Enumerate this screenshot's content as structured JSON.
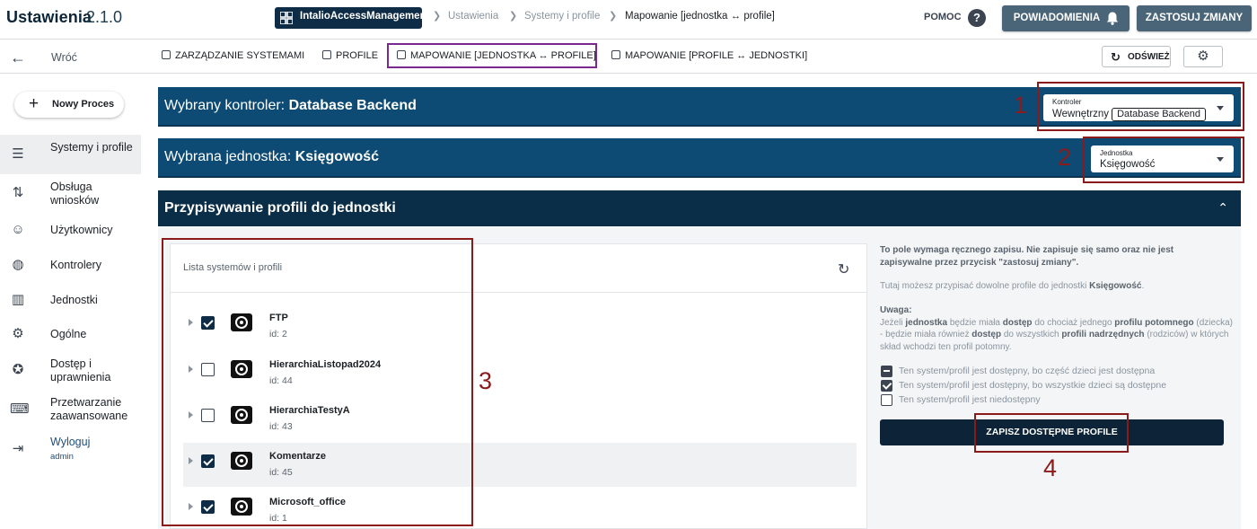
{
  "header": {
    "title": "Ustawienia",
    "version": "2.1.0",
    "breadcrumb": {
      "app": "IntalioAccessManagement",
      "items": [
        "Ustawienia",
        "Systemy i profile"
      ],
      "current": "Mapowanie [jednostka ↔ profile]"
    },
    "help_label": "POMOC",
    "notifications_label": "POWIADOMIENIA",
    "apply_label": "ZASTOSUJ ZMIANY"
  },
  "subnav": {
    "back_label": "Wróć",
    "tabs": [
      {
        "label": "ZARZĄDZANIE SYSTEMAMI"
      },
      {
        "label": "PROFILE"
      },
      {
        "label": "MAPOWANIE [JEDNOSTKA ↔ PROFILE]"
      },
      {
        "label": "MAPOWANIE [PROFILE ↔ JEDNOSTKI]"
      }
    ],
    "active_tab": "MAPOWANIE [JEDNOSTKA ↔ PROFILE]",
    "refresh_label": "ODŚWIEŻ"
  },
  "sidebar": {
    "new_process_label": "Nowy Proces",
    "items": [
      {
        "label": "Systemy i profile",
        "icon": "server-icon",
        "active": true
      },
      {
        "label": "Obsługa wniosków",
        "icon": "workflow-icon"
      },
      {
        "label": "Użytkownicy",
        "icon": "users-icon"
      },
      {
        "label": "Kontrolery",
        "icon": "globe-icon"
      },
      {
        "label": "Jednostki",
        "icon": "building-icon"
      },
      {
        "label": "Ogólne",
        "icon": "settings-chip-icon"
      },
      {
        "label": "Dostęp i uprawnienia",
        "icon": "badge-icon"
      },
      {
        "label": "Przetwarzanie zaawansowane",
        "icon": "terminal-icon"
      },
      {
        "label": "Wyloguj",
        "icon": "logout-icon",
        "sub": "admin"
      }
    ]
  },
  "controller_bar": {
    "label": "Wybrany kontroler:",
    "value": "Database Backend",
    "dropdown": {
      "caption": "Kontroler",
      "prefix": "Wewnętrzny",
      "chip": "Database Backend"
    }
  },
  "unit_bar": {
    "label": "Wybrana jednostka:",
    "value": "Księgowość",
    "dropdown": {
      "caption": "Jednostka",
      "value": "Księgowość"
    }
  },
  "assign": {
    "title": "Przypisywanie profili do jednostki",
    "list_title": "Lista systemów i profili",
    "rows": [
      {
        "name": "FTP",
        "id": "id: 2",
        "checked": true
      },
      {
        "name": "HierarchiaListopad2024",
        "id": "id: 44",
        "checked": false
      },
      {
        "name": "HierarchiaTestyA",
        "id": "id: 43",
        "checked": false
      },
      {
        "name": "Komentarze",
        "id": "id: 45",
        "checked": true,
        "highlighted": true
      },
      {
        "name": "Microsoft_office",
        "id": "id: 1",
        "checked": true
      }
    ],
    "info": {
      "warning_line1": "To pole wymaga ręcznego zapisu. Nie zapisuje się samo oraz nie jest",
      "warning_line2": "zapisywalne przez przycisk \"zastosuj zmiany\".",
      "assign_prefix": "Tutaj możesz przypisać dowolne profile do jednostki",
      "assign_unit": "Księgowość",
      "assign_suffix": ".",
      "note_title": "Uwaga:",
      "note_p1": "Jeżeli",
      "note_b1": "jednostka",
      "note_p2": "będzie miała",
      "note_b2": "dostęp",
      "note_p3": "do chociaż jednego",
      "note_b3": "profilu potomnego",
      "note_p4": "(dziecka) - będzie miała również",
      "note_b4": "dostęp",
      "note_p5": "do wszystkich",
      "note_b5": "profili nadrzędnych",
      "note_p6": "(rodziców) w których skład wchodzi ten profil potomny."
    },
    "legend": [
      {
        "state": "indeterminate",
        "text": "Ten system/profil jest dostępny, bo część dzieci jest dostępna"
      },
      {
        "state": "checked",
        "text": "Ten system/profil jest dostępny, bo wszystkie dzieci są dostępne"
      },
      {
        "state": "unchecked",
        "text": "Ten system/profil jest niedostępny"
      }
    ],
    "save_label": "ZAPISZ DOSTĘPNE PROFILE"
  },
  "annotations": [
    "1",
    "2",
    "3",
    "4"
  ],
  "colors": {
    "primary_bar": "#0d4b75",
    "dark_bar": "#0a2e47",
    "annotation_red": "#8b1a1a",
    "active_tab_outline": "#7a2a8f"
  }
}
